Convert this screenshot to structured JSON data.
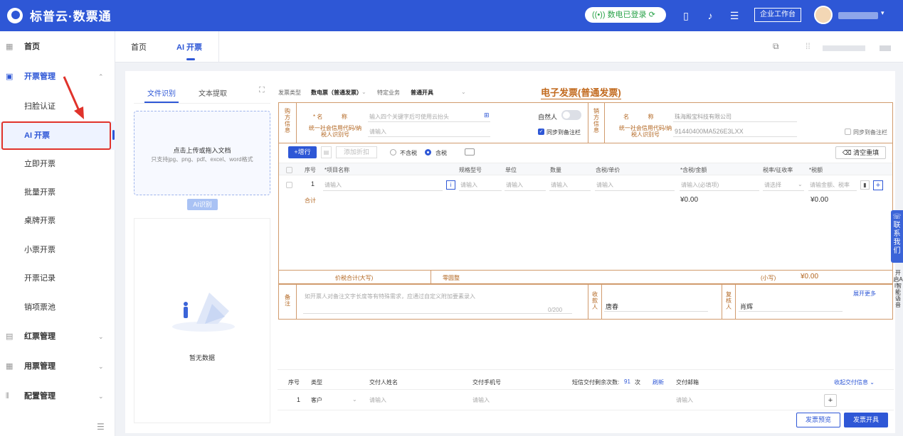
{
  "app": {
    "brand": "标普云·数票通",
    "status": "数电已登录",
    "workbench": "企业工作台"
  },
  "topbar": {
    "icons": [
      "tablet-icon",
      "bell-icon",
      "message-icon"
    ]
  },
  "sidebar": {
    "items": [
      {
        "label": "首页",
        "icon": "grid-icon"
      },
      {
        "label": "开票管理",
        "icon": "invoice-icon",
        "expanded": true
      },
      {
        "label": "扫脸认证"
      },
      {
        "label": "AI 开票",
        "active": true
      },
      {
        "label": "立即开票"
      },
      {
        "label": "批量开票"
      },
      {
        "label": "桌牌开票"
      },
      {
        "label": "小票开票"
      },
      {
        "label": "开票记录"
      },
      {
        "label": "销项票池"
      },
      {
        "label": "红票管理",
        "icon": "red-ticket-icon"
      },
      {
        "label": "用票管理",
        "icon": "grid-icon"
      },
      {
        "label": "配置管理",
        "icon": "settings-icon"
      }
    ]
  },
  "tabs": [
    {
      "label": "首页"
    },
    {
      "label": "AI 开票",
      "active": true
    }
  ],
  "left": {
    "tabs": [
      "文件识别",
      "文本提取"
    ],
    "upload_title": "点击上传或拖入文档",
    "upload_hint": "只支持jpg、png、pdf、excel、word格式",
    "ai_button": "AI识别",
    "empty": "暂无数据"
  },
  "invoice": {
    "type_label": "发票类型",
    "type_value": "数电票（普通发票）",
    "biz_label": "特定业务",
    "biz_value": "普通开具",
    "title": "电子发票(普通发票)",
    "buyer": {
      "section": "购方信息",
      "name_label": "* 名            称",
      "name_placeholder": "输入四个关键字后可使用云抬头",
      "natural_person": "自然人",
      "tax_label": "统一社会信用代码/纳税人识别号",
      "tax_placeholder": "请输入",
      "sync": "同步到备注栏"
    },
    "seller": {
      "section": "销方信息",
      "name_label": "名            称",
      "name_value": "珠海殿宝科技有限公司",
      "tax_label": "统一社会信用代码/纳税人识别号",
      "tax_value": "91440400MA526E3LXX",
      "sync": "同步到备注栏"
    },
    "toolbar": {
      "add_row": "+增行",
      "add_ext": "添加折扣",
      "excl": "不含税",
      "incl": "含税",
      "clear": "清空重填"
    },
    "columns": [
      "序号",
      "*项目名称",
      "规格型号",
      "单位",
      "数量",
      "含税/单价",
      "*含税/金额",
      "税率/征收率",
      "*税额"
    ],
    "row": {
      "index": "1",
      "name": "请输入",
      "spec": "请输入",
      "unit": "请输入",
      "qty": "请输入",
      "price": "请输入",
      "amount": "请输入(必填项)",
      "rate": "请选择",
      "tax": "请输金额、税率"
    },
    "subtotal": {
      "label": "合计",
      "amount": "¥0.00",
      "tax": "¥0.00"
    },
    "total": {
      "label": "价税合计(大写)",
      "upper": "零圆整",
      "small_label": "(小写)",
      "small": "¥0.00"
    },
    "remark": {
      "label": "备注",
      "placeholder": "如开票人对备注文字长度等有特殊需求，应通过自定义附加要素录入",
      "counter": "0/200",
      "more": "展开更多"
    },
    "payee": {
      "label": "收款人",
      "value": "唐春"
    },
    "reviewer": {
      "label": "复核人",
      "value": "肖辉"
    }
  },
  "delivery": {
    "headers": [
      "序号",
      "类型",
      "交付人姓名",
      "交付手机号"
    ],
    "sms_label": "短信交付剩余次数:",
    "sms_count": "91",
    "sms_unit": "次",
    "refresh": "刷新",
    "email_label": "交付邮箱",
    "collapse": "收起交付信息",
    "row": {
      "index": "1",
      "type": "客户",
      "name": "请输入",
      "phone": "请输入",
      "email": "请输入"
    }
  },
  "side": {
    "contact": "联系我们",
    "ai": "开启AI智能语音"
  },
  "footer": {
    "preview": "发票预览",
    "issue": "发票开具"
  }
}
